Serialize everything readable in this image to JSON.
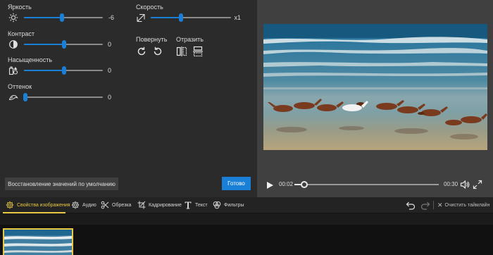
{
  "adjust": {
    "brightness": {
      "label": "Яркость",
      "value": "-6",
      "icon": "sun-icon",
      "level": 0.44
    },
    "contrast": {
      "label": "Контраст",
      "value": "0",
      "icon": "contrast-icon",
      "level": 0.5
    },
    "saturation": {
      "label": "Насыщенность",
      "value": "0",
      "icon": "saturation-icon",
      "level": 0.5
    },
    "tint": {
      "label": "Оттенок",
      "value": "0",
      "icon": "tint-icon",
      "level": 0.0
    }
  },
  "speed": {
    "label": "Скорость",
    "value": "x1",
    "icon": "speed-icon",
    "level": 0.38
  },
  "rotate": {
    "label": "Повернуть",
    "cw_icon": "rotate-right-icon",
    "ccw_icon": "rotate-left-icon"
  },
  "flip": {
    "label": "Отразить",
    "h_icon": "flip-horizontal-icon",
    "v_icon": "flip-vertical-icon"
  },
  "buttons": {
    "reset": "Восстановление значений по умолчанию",
    "done": "Готово"
  },
  "player": {
    "current": "00:02",
    "total": "00:30",
    "progress": 0.07
  },
  "tabs": [
    {
      "label": "Свойства изображения",
      "icon": "gear-icon"
    },
    {
      "label": "Аудио",
      "icon": "gear-audio-icon"
    },
    {
      "label": "Обрезка",
      "icon": "scissors-icon"
    },
    {
      "label": "Кадрирование",
      "icon": "crop-icon"
    },
    {
      "label": "Текст",
      "icon": "text-icon"
    },
    {
      "label": "Фильтры",
      "icon": "filters-icon"
    }
  ],
  "toolbar": {
    "clear": "Очистить таймлайн"
  },
  "colors": {
    "accent": "#1a7fd6",
    "active_tab": "#e8c840"
  }
}
